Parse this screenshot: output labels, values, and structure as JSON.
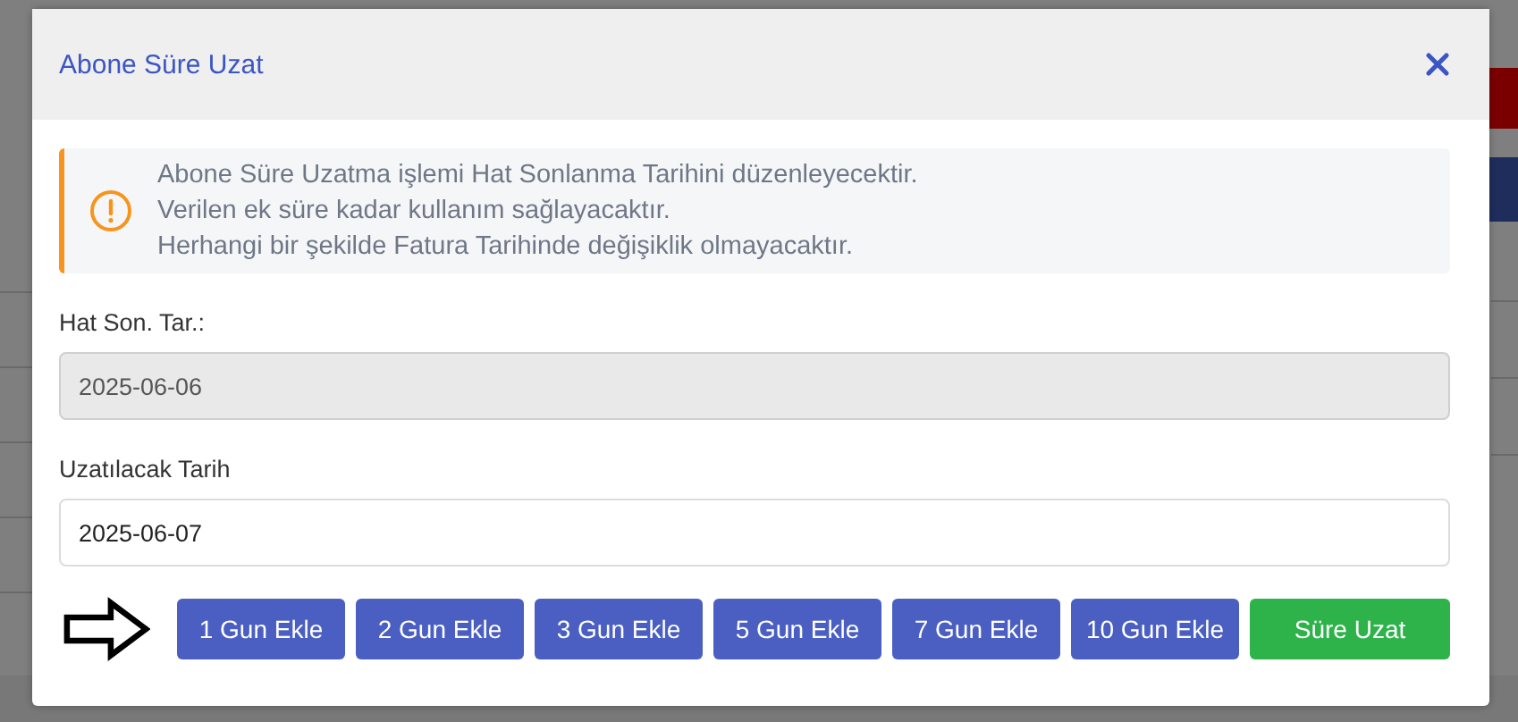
{
  "dialog": {
    "title": "Abone Süre Uzat",
    "alert": {
      "kind": "warning",
      "lines": [
        "Abone Süre Uzatma işlemi Hat Sonlanma Tarihini düzenleyecektir.",
        "Verilen ek süre kadar kullanım sağlayacaktır.",
        "Herhangi bir şekilde Fatura Tarihinde değişiklik olmayacaktır."
      ]
    },
    "fields": [
      {
        "label": "Hat Son. Tar.:",
        "value": "2025-06-06",
        "disabled": true
      },
      {
        "label": "Uzatılacak Tarih",
        "value": "2025-06-07",
        "disabled": false
      }
    ],
    "buttons": [
      {
        "label": "1 Gun Ekle",
        "kind": "secondary"
      },
      {
        "label": "2 Gun Ekle",
        "kind": "secondary"
      },
      {
        "label": "3 Gun Ekle",
        "kind": "secondary"
      },
      {
        "label": "5 Gun Ekle",
        "kind": "secondary"
      },
      {
        "label": "7 Gun Ekle",
        "kind": "secondary"
      },
      {
        "label": "10 Gun Ekle",
        "kind": "secondary"
      },
      {
        "label": "Süre Uzat",
        "kind": "primary"
      }
    ]
  }
}
